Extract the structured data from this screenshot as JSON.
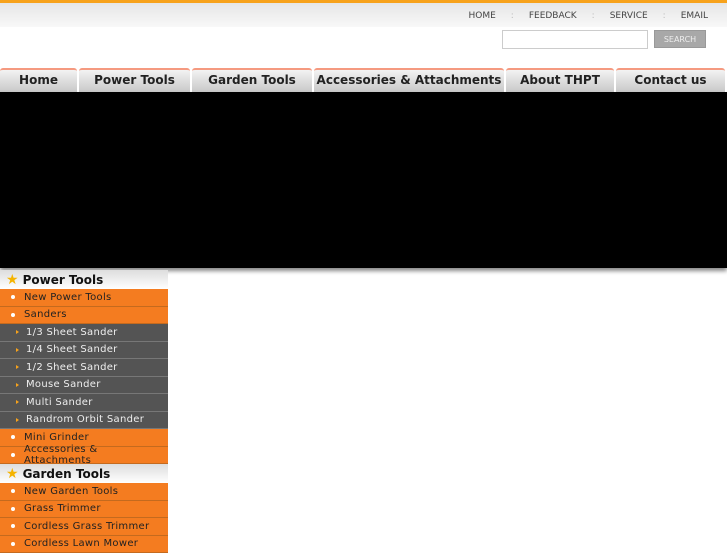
{
  "top_links": [
    "HOME",
    "FEEDBACK",
    "SERVICE",
    "EMAIL"
  ],
  "search": {
    "value": "",
    "button": "SEARCH"
  },
  "nav": [
    "Home",
    "Power Tools",
    "Garden Tools",
    "Accessories & Attachments",
    "About THPT",
    "Contact us"
  ],
  "sidebar": {
    "power": {
      "title": "Power Tools",
      "items": [
        {
          "label": "New Power Tools",
          "sub": false
        },
        {
          "label": "Sanders",
          "sub": false
        },
        {
          "label": "1/3 Sheet Sander",
          "sub": true
        },
        {
          "label": "1/4 Sheet Sander",
          "sub": true
        },
        {
          "label": "1/2 Sheet Sander",
          "sub": true
        },
        {
          "label": "Mouse Sander",
          "sub": true
        },
        {
          "label": "Multi Sander",
          "sub": true
        },
        {
          "label": "Randrom Orbit Sander",
          "sub": true
        },
        {
          "label": "Mini Grinder",
          "sub": false
        },
        {
          "label": "Accessories & Attachments",
          "sub": false
        }
      ]
    },
    "garden": {
      "title": "Garden Tools",
      "items": [
        {
          "label": "New Garden Tools",
          "sub": false
        },
        {
          "label": "Grass Trimmer",
          "sub": false
        },
        {
          "label": "Cordless Grass Trimmer",
          "sub": false
        },
        {
          "label": "Cordless Lawn Mower",
          "sub": false
        }
      ]
    }
  }
}
